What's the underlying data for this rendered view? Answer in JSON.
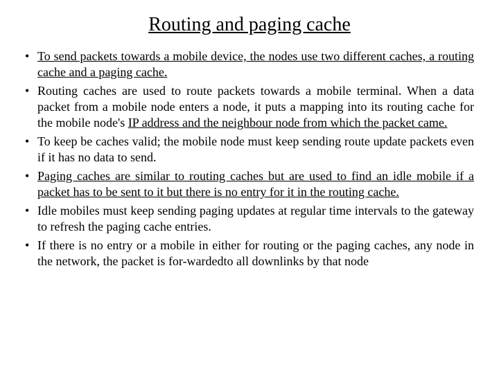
{
  "title": "Routing and paging cache",
  "bullets": [
    {
      "html": "<span class=\"u\">To send packets towards a mobile device, the nodes use two different caches, a routing cache and a paging cache.</span>"
    },
    {
      "html": "Routing caches are used to route packets towards a mobile terminal. When a data packet from a mobile node enters a node, it puts a mapping into its routing cache for the mobile node's <span class=\"u\">IP address and the neighbour node from which the packet came.</span>"
    },
    {
      "html": "To keep be caches valid; the mobile node must keep sending route update packets even if it has no data to send."
    },
    {
      "html": "<span class=\"u\">Paging caches are similar to routing caches but are used to find an idle mobile if a packet has to be sent to it but there is no entry for it in the routing cache.</span>"
    },
    {
      "html": "Idle mobiles must keep sending paging updates at regular time intervals to the gateway to refresh the paging cache entries."
    },
    {
      "html": "If there is no entry or a mobile in either for routing or the paging caches, any node in the network, the packet is for-wardedto all downlinks by that node"
    }
  ]
}
